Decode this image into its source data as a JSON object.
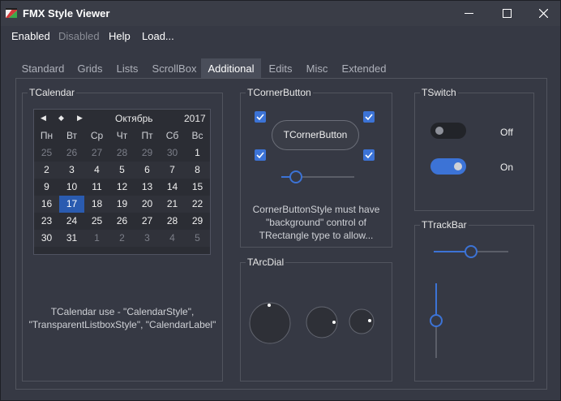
{
  "window": {
    "title": "FMX Style Viewer",
    "controls": {
      "minimize": "—",
      "maximize": "☐",
      "close": "✕"
    }
  },
  "menu": [
    {
      "label": "Enabled",
      "disabled": false
    },
    {
      "label": "Disabled",
      "disabled": true
    },
    {
      "label": "Help",
      "disabled": false
    },
    {
      "label": "Load...",
      "disabled": false
    }
  ],
  "tabs": [
    {
      "label": "Standard",
      "active": false
    },
    {
      "label": "Grids",
      "active": false
    },
    {
      "label": "Lists",
      "active": false
    },
    {
      "label": "ScrollBox",
      "active": false
    },
    {
      "label": "Additional",
      "active": true
    },
    {
      "label": "Edits",
      "active": false
    },
    {
      "label": "Misc",
      "active": false
    },
    {
      "label": "Extended",
      "active": false
    }
  ],
  "calendar": {
    "group_title": "TCalendar",
    "nav": {
      "prev": "◀",
      "today": "◆",
      "next": "▶"
    },
    "month": "Октябрь",
    "year": "2017",
    "weekdays": [
      "Пн",
      "Вт",
      "Ср",
      "Чт",
      "Пт",
      "Сб",
      "Вс"
    ],
    "weeks": [
      [
        "25",
        "26",
        "27",
        "28",
        "29",
        "30",
        "1"
      ],
      [
        "2",
        "3",
        "4",
        "5",
        "6",
        "7",
        "8"
      ],
      [
        "9",
        "10",
        "11",
        "12",
        "13",
        "14",
        "15"
      ],
      [
        "16",
        "17",
        "18",
        "19",
        "20",
        "21",
        "22"
      ],
      [
        "23",
        "24",
        "25",
        "26",
        "27",
        "28",
        "29"
      ],
      [
        "30",
        "31",
        "1",
        "2",
        "3",
        "4",
        "5"
      ]
    ],
    "selected": "17",
    "note_line1": "TCalendar use - \"CalendarStyle\",",
    "note_line2": "\"TransparentListboxStyle\", \"CalendarLabel\""
  },
  "corner_button": {
    "group_title": "TCornerButton",
    "button_label": "TCornerButton",
    "slider_value": 0.2,
    "note_line1": "CornerButtonStyle must have",
    "note_line2": "\"background\" control of",
    "note_line3": "TRectangle type to allow..."
  },
  "switch": {
    "group_title": "TSwitch",
    "off_label": "Off",
    "on_label": "On"
  },
  "arcdial": {
    "group_title": "TArcDial"
  },
  "trackbar": {
    "group_title": "TTrackBar",
    "horizontal_value": 0.5,
    "vertical_value": 0.5
  },
  "colors": {
    "accent": "#3c73d6",
    "selected_day": "#2a5bb0",
    "background": "#363944"
  }
}
